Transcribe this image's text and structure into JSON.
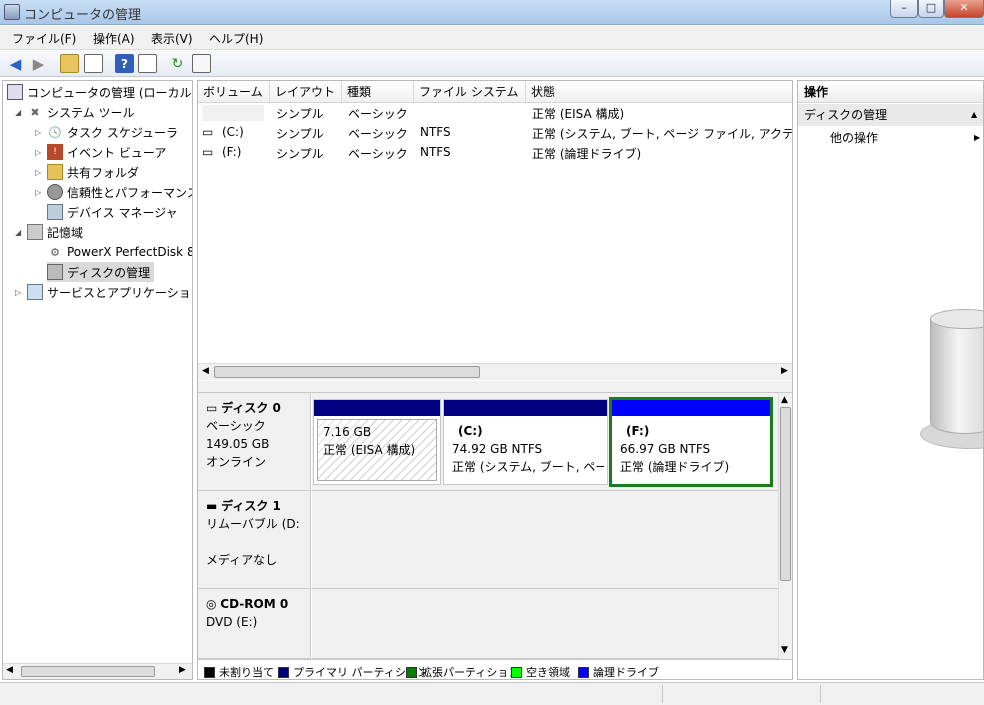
{
  "window": {
    "title": "コンピュータの管理"
  },
  "menu": [
    "ファイル(F)",
    "操作(A)",
    "表示(V)",
    "ヘルプ(H)"
  ],
  "tree": [
    {
      "label": "コンピュータの管理 (ローカル)",
      "icon": "computer-icon"
    },
    {
      "label": "システム ツール",
      "icon": "tools-icon"
    },
    {
      "label": "タスク スケジューラ",
      "icon": "clock-icon"
    },
    {
      "label": "イベント ビューア",
      "icon": "event-viewer-icon"
    },
    {
      "label": "共有フォルダ",
      "icon": "shared-folder-icon"
    },
    {
      "label": "信頼性とパフォーマンス",
      "icon": "performance-icon"
    },
    {
      "label": "デバイス マネージャ",
      "icon": "device-manager-icon"
    },
    {
      "label": "記憶域",
      "icon": "storage-icon"
    },
    {
      "label": "PowerX PerfectDisk 8",
      "icon": "perfectdisk-icon"
    },
    {
      "label": "ディスクの管理",
      "icon": "disk-management-icon"
    },
    {
      "label": "サービスとアプリケーション",
      "icon": "services-icon"
    }
  ],
  "volume_table": {
    "headers": [
      "ボリューム",
      "レイアウト",
      "種類",
      "ファイル システム",
      "状態"
    ],
    "rows": [
      [
        "",
        "シンプル",
        "ベーシック",
        "",
        "正常 (EISA 構成)"
      ],
      [
        "(C:)",
        "シンプル",
        "ベーシック",
        "NTFS",
        "正常 (システム, ブート, ページ ファイル, アクティブ"
      ],
      [
        "(F:)",
        "シンプル",
        "ベーシック",
        "NTFS",
        "正常 (論理ドライブ)"
      ]
    ]
  },
  "disks": [
    {
      "name": "ディスク 0",
      "type": "ベーシック",
      "size": "149.05 GB",
      "status": "オンライン",
      "partitions": [
        {
          "title": "",
          "size": "7.16 GB",
          "status": "正常 (EISA 構成)"
        },
        {
          "title": "(C:)",
          "size": "74.92 GB NTFS",
          "status": "正常 (システム, ブート, ページ"
        },
        {
          "title": "(F:)",
          "size": "66.97 GB NTFS",
          "status": "正常 (論理ドライブ)"
        }
      ]
    },
    {
      "name": "ディスク 1",
      "type": "リムーバブル (D:",
      "status": "メディアなし"
    },
    {
      "name": "CD-ROM 0",
      "type": "DVD (E:)"
    }
  ],
  "legend": [
    {
      "label": "未割り当て",
      "color": "#000000"
    },
    {
      "label": "プライマリ パーティション",
      "color": "#00007f"
    },
    {
      "label": "拡張パーティション",
      "color": "#007f00"
    },
    {
      "label": "空き領域",
      "color": "#00ff00"
    },
    {
      "label": "論理ドライブ",
      "color": "#0000ff"
    }
  ],
  "actions": {
    "header": "操作",
    "section": "ディスクの管理",
    "more": "他の操作"
  },
  "colors": {
    "primary": "#000080",
    "logical": "#0000ff",
    "extended": "#007f00",
    "selected_border": "#1e7a1e"
  }
}
